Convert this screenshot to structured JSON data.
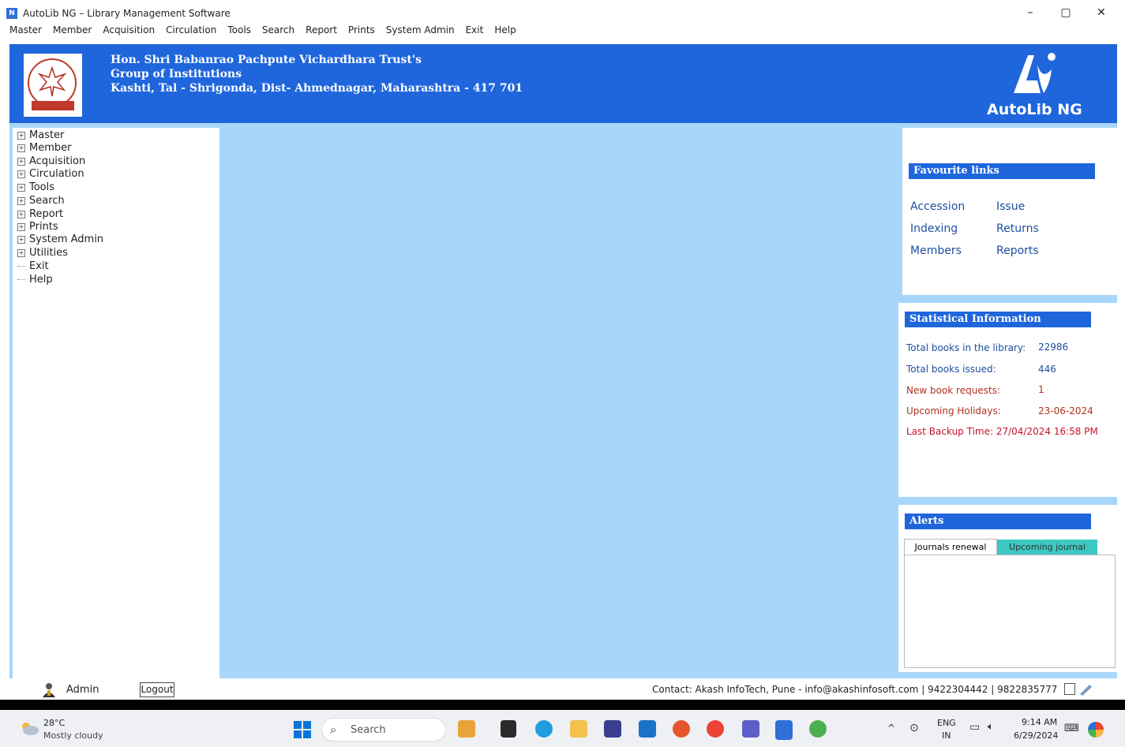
{
  "window": {
    "title": "AutoLib NG – Library Management Software",
    "app_icon": "autolib-icon",
    "controls": {
      "minimize": "–",
      "maximize": "▢",
      "close": "✕"
    }
  },
  "menubar": [
    "Master",
    "Member",
    "Acquisition",
    "Circulation",
    "Tools",
    "Search",
    "Report",
    "Prints",
    "System Admin",
    "Exit",
    "Help"
  ],
  "header": {
    "line1": "Hon. Shri Babanrao Pachpute Vichardhara Trust's",
    "line2": "Group of Institutions",
    "line3": "Kashti, Tal - Shrigonda, Dist- Ahmednagar, Maharashtra - 417 701",
    "brand": "AutoLib NG"
  },
  "tree": {
    "expandable": [
      "Master",
      "Member",
      "Acquisition",
      "Circulation",
      "Tools",
      "Search",
      "Report",
      "Prints",
      "System Admin",
      "Utilities"
    ],
    "leaves": [
      "Exit",
      "Help"
    ]
  },
  "favourite_links": {
    "title": "Favourite links",
    "col1": [
      "Accession",
      "Indexing",
      "Members"
    ],
    "col2": [
      "Issue",
      "Returns",
      "Reports"
    ]
  },
  "statistics": {
    "title": "Statistical Information",
    "rows": [
      {
        "label": "Total books in the library:",
        "value": "22986",
        "color": "#1f4fa0"
      },
      {
        "label": "Total books issued:",
        "value": "446",
        "color": "#1f4fa0"
      },
      {
        "label": "New book requests:",
        "value": "1",
        "color": "#b0301f"
      },
      {
        "label": "Upcoming Holidays:",
        "value": "23-06-2024",
        "color": "#b0301f"
      }
    ],
    "backup": "Last Backup Time: 27/04/2024 16:58 PM"
  },
  "alerts": {
    "title": "Alerts",
    "tabs": [
      "Journals renewal",
      "Upcoming journal"
    ]
  },
  "status": {
    "user": "Admin",
    "logout": "Logout",
    "contact": "Contact: Akash InfoTech, Pune - info@akashinfosoft.com | 9422304442 | 9822835777"
  },
  "taskbar": {
    "weather_temp": "28°C",
    "weather_desc": "Mostly cloudy",
    "search": "Search",
    "lang1": "ENG",
    "lang2": "IN",
    "time": "9:14 AM",
    "date": "6/29/2024"
  }
}
